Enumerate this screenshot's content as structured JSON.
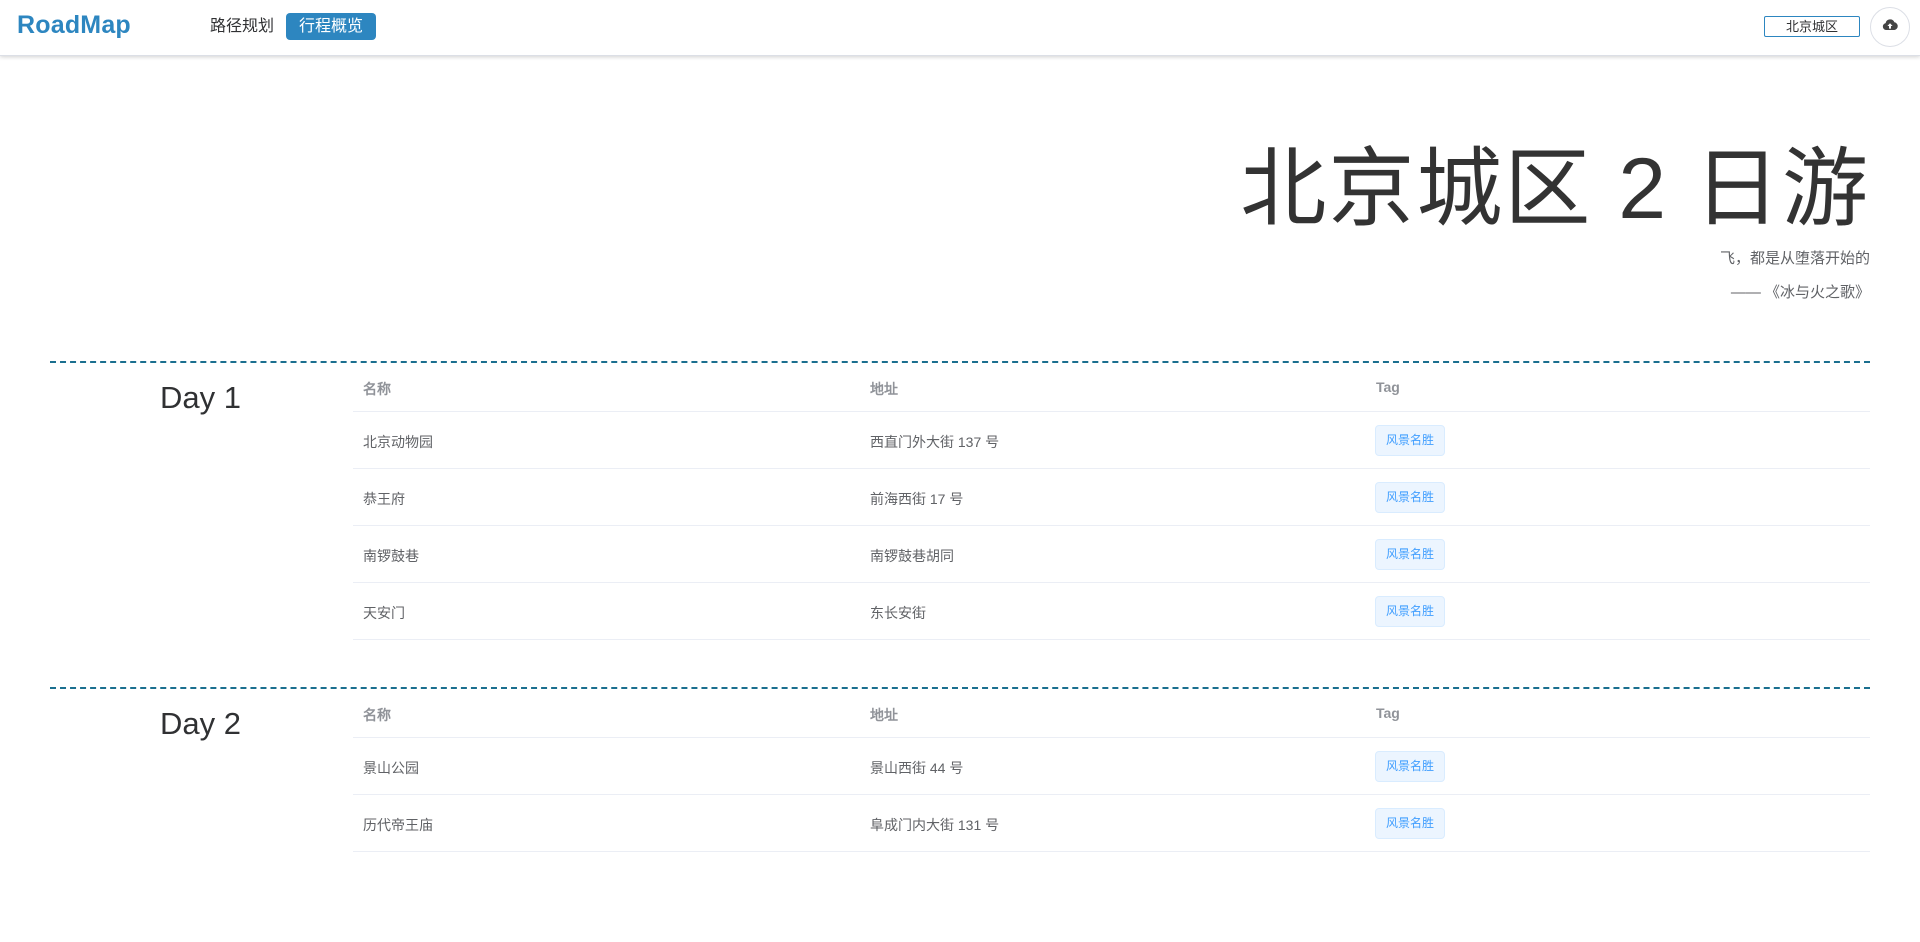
{
  "header": {
    "brand": "RoadMap",
    "nav": [
      {
        "label": "路径规划"
      },
      {
        "label": "行程概览"
      }
    ],
    "city": "北京城区"
  },
  "hero": {
    "title": "北京城区 2 日游",
    "quote_line1": "飞，都是从堕落开始的",
    "quote_line2": "—— 《冰与火之歌》"
  },
  "columns": [
    "名称",
    "地址",
    "Tag"
  ],
  "days": [
    {
      "label": "Day 1",
      "rows": [
        {
          "name": "北京动物园",
          "address": "西直门外大街 137 号",
          "tag": "风景名胜"
        },
        {
          "name": "恭王府",
          "address": "前海西街 17 号",
          "tag": "风景名胜"
        },
        {
          "name": "南锣鼓巷",
          "address": "南锣鼓巷胡同",
          "tag": "风景名胜"
        },
        {
          "name": "天安门",
          "address": "东长安街",
          "tag": "风景名胜"
        }
      ]
    },
    {
      "label": "Day 2",
      "rows": [
        {
          "name": "景山公园",
          "address": "景山西街 44 号",
          "tag": "风景名胜"
        },
        {
          "name": "历代帝王庙",
          "address": "阜成门内大街 131 号",
          "tag": "风景名胜"
        }
      ]
    }
  ],
  "icons": {
    "upload": "cloud-upload-icon"
  },
  "colors": {
    "accent": "#2d86c0",
    "divider": "#1a6f8f",
    "tag_text": "#409eff"
  }
}
